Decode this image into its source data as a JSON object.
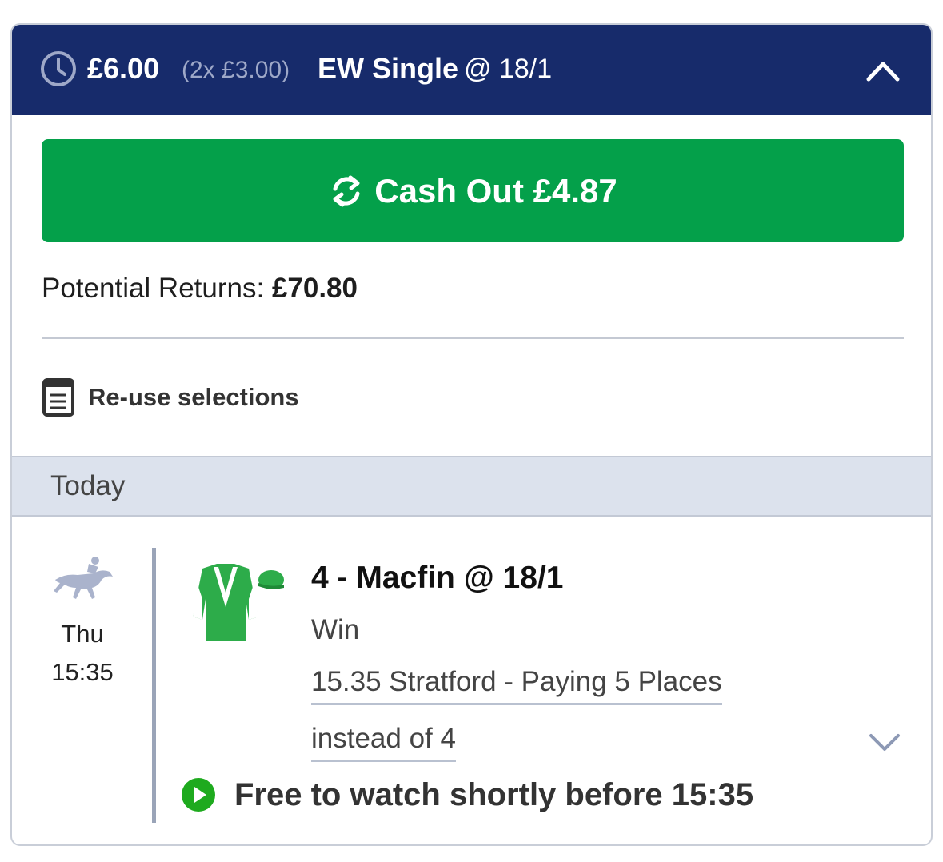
{
  "header": {
    "stake": "£6.00",
    "split": "(2x £3.00)",
    "bet_type": "EW Single",
    "odds": "@ 18/1",
    "icons": {
      "left": "clock-icon",
      "right": "chevron-up-icon"
    }
  },
  "cashout": {
    "label": "Cash Out £4.87",
    "icon": "refresh-icon",
    "color": "#04a04a"
  },
  "returns": {
    "label": "Potential Returns: ",
    "value": "£70.80"
  },
  "reuse": {
    "label": "Re-use selections",
    "icon": "document-icon"
  },
  "date_bar": {
    "label": "Today"
  },
  "selection": {
    "day": "Thu",
    "time": "15:35",
    "title": "4 - Macfin @ 18/1",
    "market": "Win",
    "race_line1": "15.35 Stratford - Paying 5 Places",
    "race_line2": "instead of 4",
    "sport_icon": "horse-racing-icon",
    "silks_icon": "jockey-silks-icon",
    "silks_colors": [
      "#2dac4a",
      "#ffffff"
    ]
  },
  "stream": {
    "label": "Free to watch shortly before 15:35",
    "icon": "play-icon",
    "color": "#1eaa1e"
  },
  "theme": {
    "header_bg": "#172b6b",
    "divider": "#c4c9d3",
    "date_bar_bg": "#dce2ed"
  }
}
